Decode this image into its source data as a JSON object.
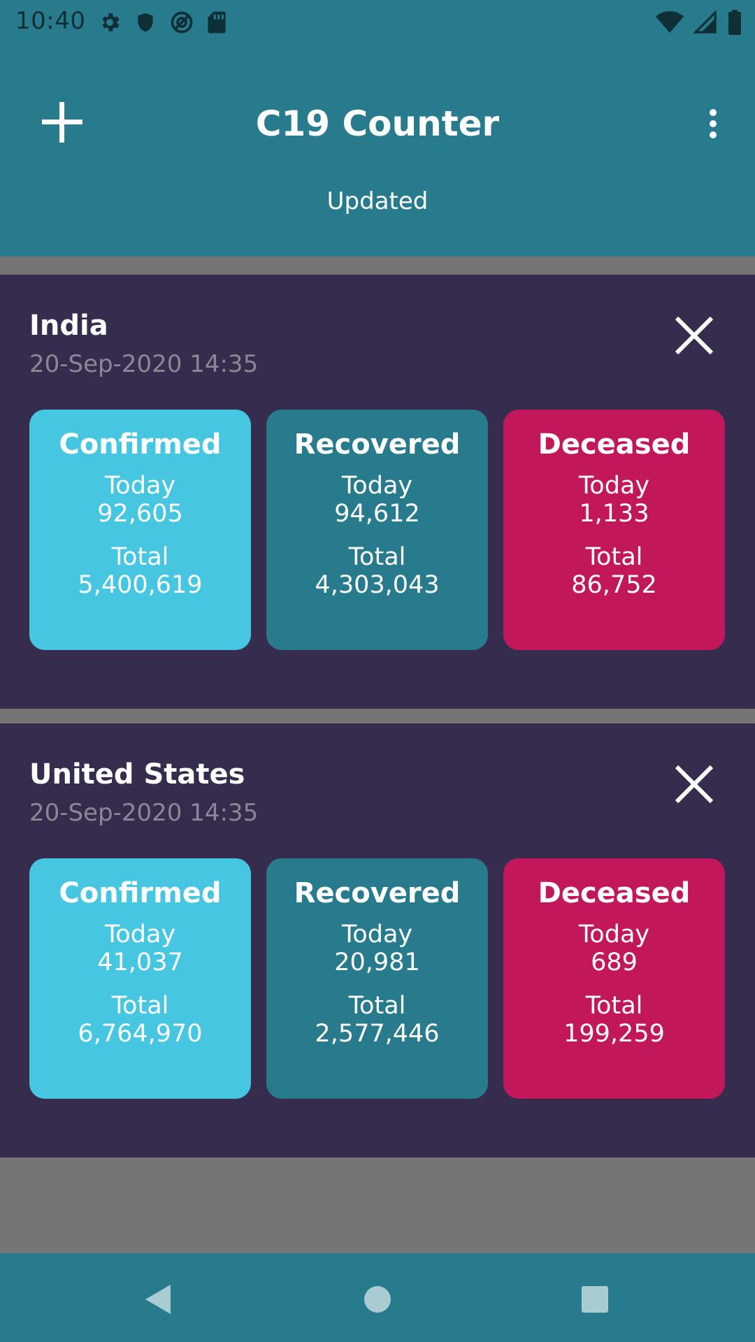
{
  "status_bar": {
    "time": "10:40",
    "icons_left": [
      "gear-icon",
      "shield-icon",
      "vpn-icon",
      "sd-card-icon"
    ],
    "icons_right": [
      "wifi-icon",
      "cell-signal-icon",
      "battery-icon"
    ]
  },
  "app_bar": {
    "title": "C19 Counter",
    "updated_label": "Updated",
    "add_icon": "plus-icon",
    "menu_icon": "more-vert-icon"
  },
  "countries": [
    {
      "name": "India",
      "date": "20-Sep-2020 14:35",
      "confirmed": {
        "title": "Confirmed",
        "today_label": "Today",
        "today": "92,605",
        "total_label": "Total",
        "total": "5,400,619"
      },
      "recovered": {
        "title": "Recovered",
        "today_label": "Today",
        "today": "94,612",
        "total_label": "Total",
        "total": "4,303,043"
      },
      "deceased": {
        "title": "Deceased",
        "today_label": "Today",
        "today": "1,133",
        "total_label": "Total",
        "total": "86,752"
      }
    },
    {
      "name": "United States",
      "date": "20-Sep-2020 14:35",
      "confirmed": {
        "title": "Confirmed",
        "today_label": "Today",
        "today": "41,037",
        "total_label": "Total",
        "total": "6,764,970"
      },
      "recovered": {
        "title": "Recovered",
        "today_label": "Today",
        "today": "20,981",
        "total_label": "Total",
        "total": "2,577,446"
      },
      "deceased": {
        "title": "Deceased",
        "today_label": "Today",
        "today": "689",
        "total_label": "Total",
        "total": "199,259"
      }
    }
  ],
  "nav_bar": {
    "icons": [
      "back-icon",
      "home-icon",
      "recents-icon"
    ]
  },
  "colors": {
    "header": "#287b8c",
    "card_background": "#362d4e",
    "confirmed": "#46c6e0",
    "recovered": "#287b8c",
    "deceased": "#c2185b",
    "page_background": "#757575"
  }
}
